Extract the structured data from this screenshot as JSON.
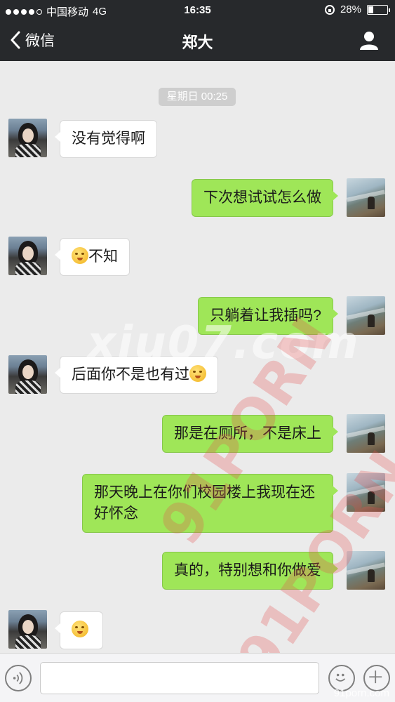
{
  "status_bar": {
    "carrier": "中国移动",
    "network": "4G",
    "time": "16:35",
    "battery_percent": "28%",
    "battery_level": 0.28,
    "signal_bars": 4
  },
  "nav": {
    "back_label": "微信",
    "title": "郑大"
  },
  "chat": {
    "timestamp": "星期日 00:25",
    "messages": [
      {
        "side": "in",
        "text": "没有觉得啊"
      },
      {
        "side": "out",
        "text": "下次想试试怎么做"
      },
      {
        "side": "in",
        "text": "不知",
        "emoji": "shy-emoji"
      },
      {
        "side": "out",
        "text": "只躺着让我插吗?"
      },
      {
        "side": "in",
        "text": "后面你不是也有过",
        "emoji": "awkward-emoji"
      },
      {
        "side": "out",
        "text": "那是在厕所，不是床上"
      },
      {
        "side": "out",
        "text_line1": "那天晚上在你们校园楼上我现在还",
        "text_line2": "好怀念"
      },
      {
        "side": "out",
        "text": "真的，特别想和你做爱"
      },
      {
        "side": "in",
        "text": "",
        "emoji": "thinking-emoji"
      }
    ]
  },
  "watermarks": {
    "center": "xiu07.com",
    "diagonal_1": "91PORN",
    "diagonal_2": "91PORN",
    "corner": "91porn.com"
  },
  "input_bar": {
    "text_value": "",
    "placeholder": ""
  },
  "colors": {
    "nav_bg": "#27292c",
    "chat_bg": "#ebebeb",
    "outgoing_bubble": "#9fe658",
    "incoming_bubble": "#ffffff"
  }
}
